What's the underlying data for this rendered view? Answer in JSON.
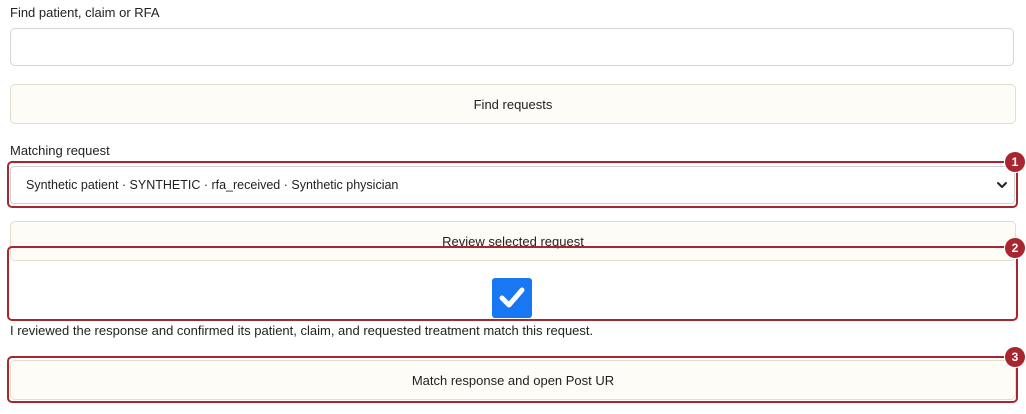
{
  "search": {
    "label": "Find patient, claim or RFA",
    "value": "",
    "placeholder": ""
  },
  "find_button": {
    "label": "Find requests"
  },
  "matching": {
    "label": "Matching request",
    "selected": "Synthetic patient · SYNTHETIC · rfa_received · Synthetic physician"
  },
  "review_button": {
    "label": "Review selected request"
  },
  "confirm": {
    "checked": true,
    "label": "I reviewed the response and confirmed its patient, claim, and requested treatment match this request."
  },
  "match_button": {
    "label": "Match response and open Post UR"
  },
  "annotations": {
    "badge_1": "1",
    "badge_2": "2",
    "badge_3": "3"
  },
  "colors": {
    "highlight": "#a8262f",
    "button_bg": "#fefcf6",
    "checkbox": "#1877f2"
  }
}
